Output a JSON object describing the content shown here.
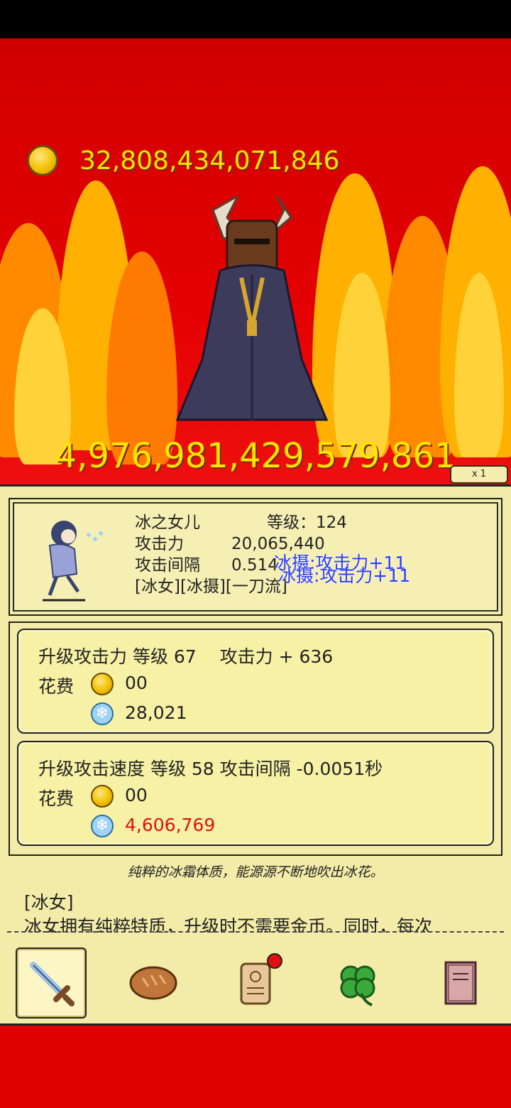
{
  "hud": {
    "gold": "32,808,434,071,846",
    "boss_hp": "4,976,981,429,579,861",
    "speed_multiplier": "x 1"
  },
  "hero": {
    "name": "冰之女儿",
    "level_label": "等级：124",
    "attack_label": "攻击力",
    "attack_value": "20,065,440",
    "interval_label": "攻击间隔",
    "interval_value": "0.514",
    "tags": "[冰女][冰摄][一刀流]",
    "floating_texts": [
      "冰摄:攻击力+11",
      "冰摄:攻击力+11"
    ]
  },
  "upgrades": [
    {
      "title": "升级攻击力 等级 67　 攻击力 + 636",
      "cost_label": "花费",
      "gold_cost": "00",
      "ice_cost": "28,021",
      "ice_insufficient": false
    },
    {
      "title": "升级攻击速度 等级 58 攻击间隔 -0.0051秒",
      "cost_label": "花费",
      "gold_cost": "00",
      "ice_cost": "4,606,769",
      "ice_insufficient": true
    }
  ],
  "flavor_text": "纯粹的冰霜体质，能源源不断地吹出冰花。",
  "skill": {
    "title": "[冰女]",
    "description": "冰女拥有纯粹特质，升级时不需要金币。同时，每次"
  },
  "nav": [
    {
      "icon": "sword-icon",
      "active": true
    },
    {
      "icon": "bread-icon",
      "active": false
    },
    {
      "icon": "scroll-icon",
      "active": false,
      "badge": true
    },
    {
      "icon": "clover-icon",
      "active": false
    },
    {
      "icon": "book-icon",
      "active": false
    }
  ],
  "colors": {
    "background_red": "#e00000",
    "hud_yellow": "#ffe600",
    "panel_bg": "#f3eba8",
    "insufficient_red": "#e01010",
    "float_blue": "#2a3cff"
  }
}
